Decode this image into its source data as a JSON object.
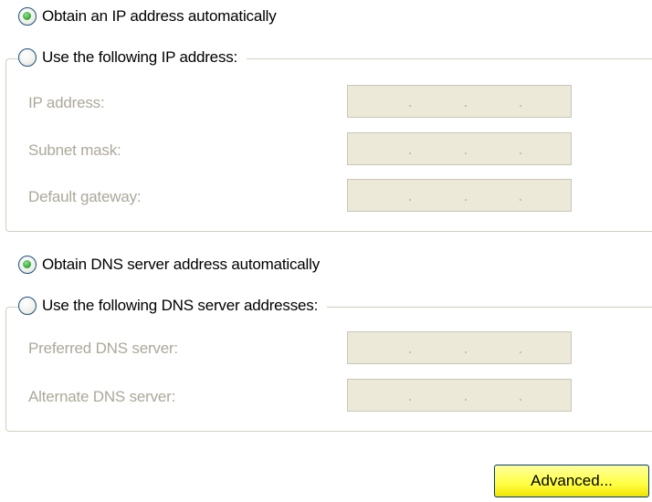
{
  "ip_section": {
    "auto_option": {
      "label": "Obtain an IP address automatically",
      "selected": true
    },
    "manual_option": {
      "label": "Use the following IP address:",
      "selected": false
    },
    "fields": [
      {
        "label": "IP address:",
        "value": ""
      },
      {
        "label": "Subnet mask:",
        "value": ""
      },
      {
        "label": "Default gateway:",
        "value": ""
      }
    ]
  },
  "dns_section": {
    "auto_option": {
      "label": "Obtain DNS server address automatically",
      "selected": true
    },
    "manual_option": {
      "label": "Use the following DNS server addresses:",
      "selected": false
    },
    "fields": [
      {
        "label": "Preferred DNS server:",
        "value": ""
      },
      {
        "label": "Alternate DNS server:",
        "value": ""
      }
    ]
  },
  "advanced_button": {
    "label": "Advanced..."
  },
  "colors": {
    "disabled_text": "#aca899",
    "disabled_field": "#ece9d8",
    "group_border": "#d0d0bf",
    "button_fill": "#ffff44",
    "radio_dot": "#2fa52f"
  }
}
